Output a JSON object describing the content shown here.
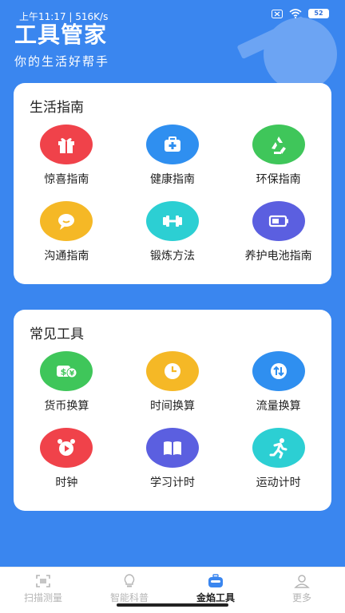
{
  "status_bar": {
    "time": "上午11:17 | 516K/s",
    "battery": "52"
  },
  "header": {
    "title": "工具管家",
    "subtitle": "你的生活好帮手"
  },
  "life_guide": {
    "title": "生活指南",
    "items": [
      {
        "label": "惊喜指南",
        "icon": "gift-icon",
        "color": "#f0424a"
      },
      {
        "label": "健康指南",
        "icon": "medical-kit-icon",
        "color": "#2f8ff0"
      },
      {
        "label": "环保指南",
        "icon": "recycle-icon",
        "color": "#3fc65a"
      },
      {
        "label": "沟通指南",
        "icon": "chat-bubble-icon",
        "color": "#f5b826"
      },
      {
        "label": "锻炼方法",
        "icon": "dumbbell-icon",
        "color": "#2ccfd3"
      },
      {
        "label": "养护电池指南",
        "icon": "battery-icon",
        "color": "#5b5fe0"
      }
    ]
  },
  "common_tools": {
    "title": "常见工具",
    "items": [
      {
        "label": "货币换算",
        "icon": "currency-exchange-icon",
        "color": "#3fc65a"
      },
      {
        "label": "时间换算",
        "icon": "clock-icon",
        "color": "#f5b826"
      },
      {
        "label": "流量换算",
        "icon": "data-transfer-icon",
        "color": "#2f8ff0"
      },
      {
        "label": "时钟",
        "icon": "alarm-clock-icon",
        "color": "#f0424a"
      },
      {
        "label": "学习计时",
        "icon": "book-icon",
        "color": "#5b5fe0"
      },
      {
        "label": "运动计时",
        "icon": "running-icon",
        "color": "#2ccfd3"
      }
    ]
  },
  "tabbar": {
    "tabs": [
      {
        "label": "扫描测量",
        "icon": "scan-icon"
      },
      {
        "label": "智能科普",
        "icon": "lightbulb-icon"
      },
      {
        "label": "金焰工具",
        "icon": "toolbox-icon",
        "active": true
      },
      {
        "label": "更多",
        "icon": "user-icon"
      }
    ]
  }
}
